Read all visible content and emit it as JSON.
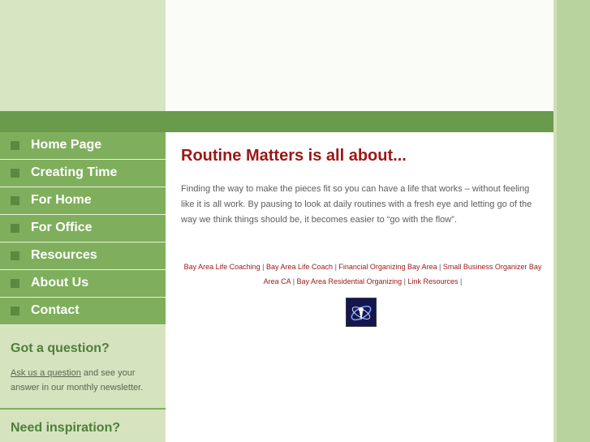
{
  "nav": {
    "items": [
      {
        "label": "Home Page"
      },
      {
        "label": "Creating Time"
      },
      {
        "label": "For Home"
      },
      {
        "label": "For Office"
      },
      {
        "label": "Resources"
      },
      {
        "label": "About Us"
      },
      {
        "label": "Contact"
      }
    ]
  },
  "sidebar": {
    "question": {
      "title": "Got a question?",
      "link": "Ask us a question",
      "text": " and see your answer in our monthly newsletter."
    },
    "inspiration": {
      "title": "Need inspiration?"
    }
  },
  "main": {
    "heading": "Routine Matters is all about...",
    "intro": "Finding the way to make the pieces fit so you can have a life that works – without feeling like it is all work. By pausing to look at daily routines with a fresh eye and letting go of the way we think things should be, it becomes easier to “go with the flow”.",
    "links": [
      "Bay Area Life Coaching",
      "Bay Area Life Coach",
      "Financial Organizing Bay Area",
      "Small Business Organizer Bay Area CA",
      "Bay Area Residential Organizing",
      "Link Resources"
    ],
    "separator": " | "
  },
  "colors": {
    "nav_bg": "#7fae5c",
    "green_bar": "#6a9a4b",
    "heading": "#9b1716",
    "sidebar_bg": "#d5e3bf"
  }
}
